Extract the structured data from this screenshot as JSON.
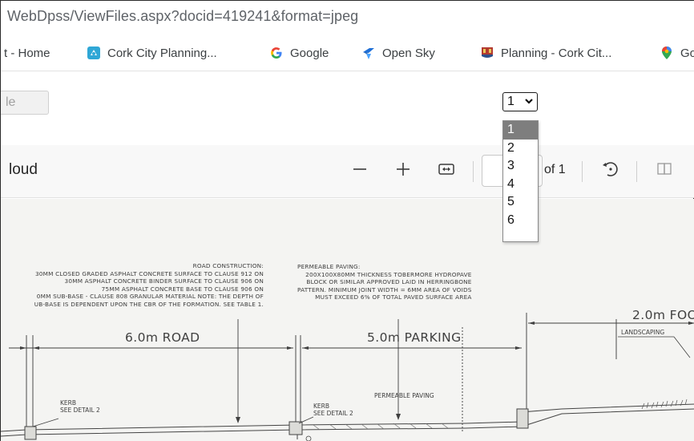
{
  "browser": {
    "url": "WebDpss/ViewFiles.aspx?docid=419241&format=jpeg"
  },
  "bookmarks": [
    {
      "label": "t - Home",
      "icon": "none"
    },
    {
      "label": "Cork City Planning...",
      "icon": "planning-portal-icon",
      "color": "#2fa7d6"
    },
    {
      "label": "Google",
      "icon": "google-icon"
    },
    {
      "label": "Open Sky",
      "icon": "open-sky-icon",
      "color": "#1f6fd6"
    },
    {
      "label": "Planning - Cork Cit...",
      "icon": "cork-city-crest-icon",
      "color": "#b33a2f"
    },
    {
      "label": "Go",
      "icon": "maps-pin-icon"
    }
  ],
  "page_controls": {
    "partial_button_label": "le",
    "page_select": {
      "value": "1",
      "options": [
        "1",
        "2",
        "3",
        "4",
        "5",
        "6"
      ],
      "highlight_color": "#7e7e7e"
    }
  },
  "pdf_toolbar": {
    "title": "loud",
    "zoom_out_icon": "minus-icon",
    "zoom_in_icon": "plus-icon",
    "fit_icon": "fit-width-icon",
    "page_input_value": "",
    "page_total_label": "of 1",
    "rotate_icon": "rotate-icon",
    "partial_icon": "page-view-icon"
  },
  "drawing": {
    "road_construction_note": [
      "ROAD CONSTRUCTION:",
      "30mm CLOSED GRADED ASPHALT CONCRETE SURFACE TO CLAUSE 912 ON",
      "30mm ASPHALT CONCRETE BINDER SURFACE TO CLAUSE 906 ON",
      "75mm ASPHALT CONCRETE BASE TO CLAUSE 906 ON",
      "0mm SUB-BASE - CLAUSE 808 GRANULAR MATERIAL NOTE: THE DEPTH OF",
      "UB-BASE IS DEPENDENT UPON THE CBR OF THE FORMATION. SEE TABLE 1."
    ],
    "permeable_paving_note": [
      "PERMEABLE PAVING:",
      "200X100X80mm THICKNESS TOBERMORE HYDROPAVE",
      "BLOCK OR SIMILAR APPROVED LAID IN HERRINGBONE",
      "PATTERN. MINIMUM JOINT WIDTH = 6mm AREA OF VOIDS",
      "MUST EXCEED 6% OF TOTAL PAVED SURFACE AREA"
    ],
    "dim_road": "6.0m ROAD",
    "dim_parking": "5.0m PARKING",
    "dim_footpath": "2.0m FOO",
    "landscaping": "LANDSCAPING",
    "kerb_1": [
      "KERB",
      "SEE DETAIL 2"
    ],
    "kerb_2": [
      "KERB",
      "SEE DETAIL 2"
    ],
    "permeable_label": "PERMEABLE PAVING"
  }
}
